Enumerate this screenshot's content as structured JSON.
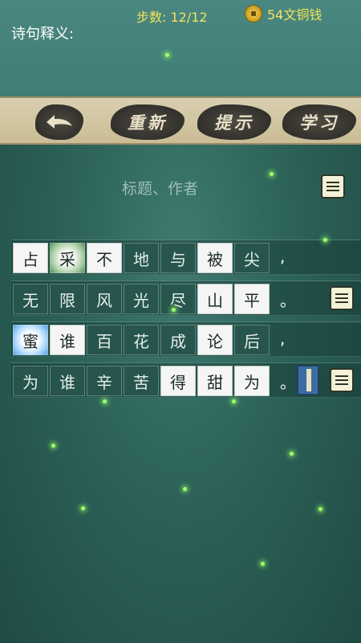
{
  "header": {
    "steps_label": "步数:",
    "steps_value": "12/12",
    "coins": "54文铜钱",
    "meaning_label": "诗句释义:"
  },
  "toolbar": {
    "reset_label": "重新",
    "hint_label": "提示",
    "learn_label": "学习"
  },
  "poem": {
    "title_author": "标题、作者",
    "rows": [
      {
        "chars": [
          "占",
          "采",
          "不",
          "地",
          "与",
          "被",
          "尖"
        ],
        "punct": ","
      },
      {
        "chars": [
          "无",
          "限",
          "风",
          "光",
          "尽",
          "山",
          "平"
        ],
        "punct": "。"
      },
      {
        "chars": [
          "蜜",
          "谁",
          "百",
          "花",
          "成",
          "论",
          "后"
        ],
        "punct": ","
      },
      {
        "chars": [
          "为",
          "谁",
          "辛",
          "苦",
          "得",
          "甜",
          "为"
        ],
        "punct": "。"
      }
    ]
  },
  "icons": {
    "back": "back-arrow-icon",
    "coin": "copper-coin-icon",
    "doc": "document-icon",
    "book": "book-icon"
  },
  "colors": {
    "accent_yellow": "#f2e35a",
    "toolbar_bg": "#cabd95",
    "bg_teal": "#2c6258"
  }
}
